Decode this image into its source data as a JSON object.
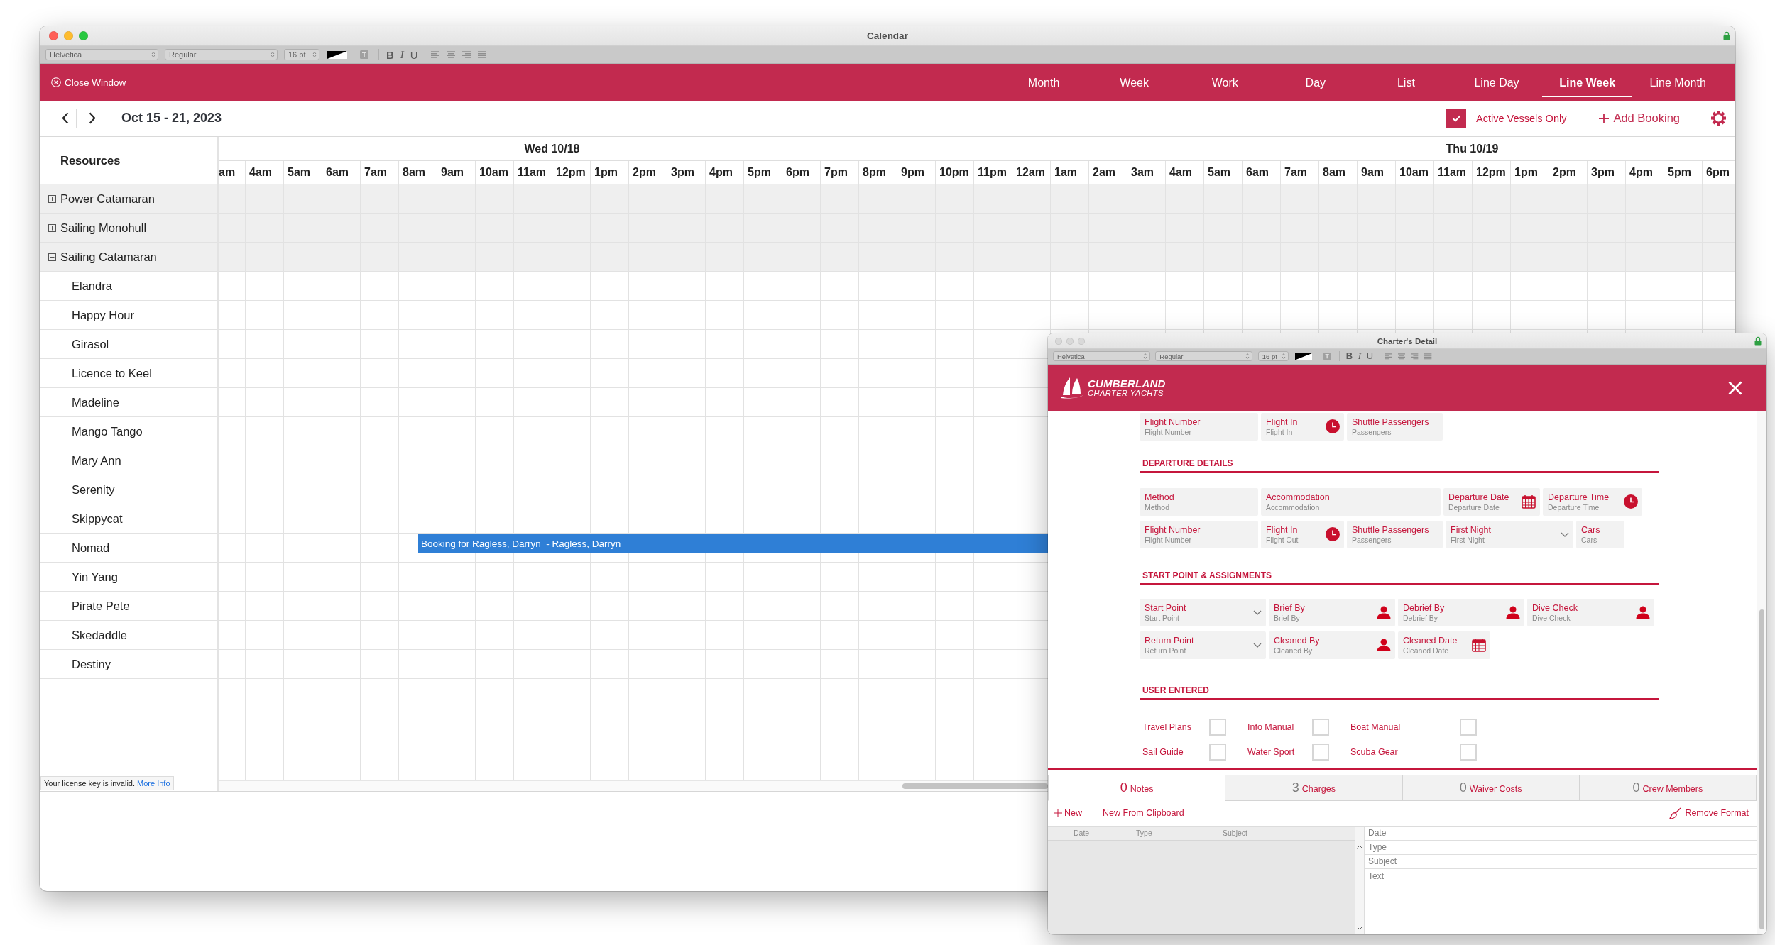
{
  "calendar_window": {
    "title": "Calendar",
    "format_bar": {
      "font": "Helvetica",
      "style": "Regular",
      "size": "16 pt",
      "bold": "B",
      "italic": "I",
      "underline": "U"
    },
    "header": {
      "close_button": "Close Window",
      "views": [
        {
          "label": "Month",
          "selected": false
        },
        {
          "label": "Week",
          "selected": false
        },
        {
          "label": "Work",
          "selected": false
        },
        {
          "label": "Day",
          "selected": false
        },
        {
          "label": "List",
          "selected": false
        },
        {
          "label": "Line Day",
          "selected": false
        },
        {
          "label": "Line Week",
          "selected": true
        },
        {
          "label": "Line Month",
          "selected": false
        }
      ]
    },
    "toolbar": {
      "date_range": "Oct 15 - 21, 2023",
      "active_vessels_only": {
        "label": "Active Vessels Only",
        "checked": true
      },
      "add_booking": "Add Booking"
    },
    "scheduler": {
      "resources_heading": "Resources",
      "days": [
        {
          "label": "Wed 10/18",
          "hours": [
            "am",
            "4am",
            "5am",
            "6am",
            "7am",
            "8am",
            "9am",
            "10am",
            "11am",
            "12pm",
            "1pm",
            "2pm",
            "3pm",
            "4pm",
            "5pm",
            "6pm",
            "7pm",
            "8pm",
            "9pm",
            "10pm",
            "11pm"
          ]
        },
        {
          "label": "Thu 10/19",
          "hours": [
            "12am",
            "1am",
            "2am",
            "3am",
            "4am",
            "5am",
            "6am",
            "7am",
            "8am",
            "9am",
            "10am",
            "11am",
            "12pm",
            "1pm",
            "2pm",
            "3pm",
            "4pm",
            "5pm",
            "6pm"
          ]
        }
      ],
      "resources": [
        {
          "name": "Power Catamaran",
          "expanded": false
        },
        {
          "name": "Sailing Monohull",
          "expanded": false
        },
        {
          "name": "Sailing Catamaran",
          "expanded": true,
          "children": [
            {
              "name": "Elandra"
            },
            {
              "name": "Happy Hour"
            },
            {
              "name": "Girasol"
            },
            {
              "name": "Licence to Keel"
            },
            {
              "name": "Madeline"
            },
            {
              "name": "Mango Tango"
            },
            {
              "name": "Mary Ann"
            },
            {
              "name": "Serenity"
            },
            {
              "name": "Skippycat"
            },
            {
              "name": "Nomad",
              "booking": "Booking for Ragless, Darryn  - Ragless, Darryn"
            },
            {
              "name": "Yin Yang"
            },
            {
              "name": "Pirate Pete"
            },
            {
              "name": "Skedaddle"
            },
            {
              "name": "Destiny"
            }
          ]
        }
      ]
    },
    "license_notice": {
      "text": "Your license key is invalid.",
      "link": "More Info"
    }
  },
  "detail_window": {
    "title": "Charter's Detail",
    "format_bar": {
      "font": "Helvetica",
      "style": "Regular",
      "size": "16 pt",
      "bold": "B",
      "italic": "I",
      "underline": "U"
    },
    "logo": {
      "name": "CUMBERLAND",
      "tagline": "CHARTER YACHTS"
    },
    "sections": [
      {
        "field_groups": [
          {
            "fields": [
              {
                "kind": "text",
                "label": "Flight Number",
                "placeholder": "Flight Number"
              },
              {
                "kind": "time",
                "label": "Flight In",
                "placeholder": "Flight In"
              },
              {
                "kind": "text",
                "label": "Shuttle Passengers",
                "placeholder": "Passengers"
              }
            ]
          }
        ]
      },
      {
        "title": "DEPARTURE DETAILS",
        "field_groups": [
          {
            "fields": [
              {
                "kind": "text",
                "label": "Method",
                "placeholder": "Method"
              },
              {
                "kind": "text",
                "label": "Accommodation",
                "placeholder": "Accommodation"
              },
              {
                "kind": "date",
                "label": "Departure Date",
                "placeholder": "Departure Date"
              },
              {
                "kind": "time",
                "label": "Departure Time",
                "placeholder": "Departure Time"
              }
            ]
          },
          {
            "fields": [
              {
                "kind": "text",
                "label": "Flight Number",
                "placeholder": "Flight Number"
              },
              {
                "kind": "time",
                "label": "Flight In",
                "placeholder": "Flight Out"
              },
              {
                "kind": "text",
                "label": "Shuttle Passengers",
                "placeholder": "Passengers"
              },
              {
                "kind": "select",
                "label": "First Night",
                "placeholder": "First Night"
              },
              {
                "kind": "text",
                "label": "Cars",
                "placeholder": "Cars"
              }
            ]
          }
        ]
      },
      {
        "title": "START POINT & ASSIGNMENTS",
        "field_groups": [
          {
            "fields": [
              {
                "kind": "select",
                "label": "Start Point",
                "placeholder": "Start Point"
              },
              {
                "kind": "person",
                "label": "Brief By",
                "placeholder": "Brief By"
              },
              {
                "kind": "person",
                "label": "Debrief By",
                "placeholder": "Debrief By"
              },
              {
                "kind": "person",
                "label": "Dive Check",
                "placeholder": "Dive Check"
              }
            ]
          },
          {
            "fields": [
              {
                "kind": "select",
                "label": "Return Point",
                "placeholder": "Return Point"
              },
              {
                "kind": "person",
                "label": "Cleaned By",
                "placeholder": "Cleaned By"
              },
              {
                "kind": "date",
                "label": "Cleaned Date",
                "placeholder": "Cleaned Date"
              }
            ]
          }
        ]
      },
      {
        "title": "USER ENTERED",
        "checkboxes": [
          {
            "label": "Travel Plans",
            "checked": false
          },
          {
            "label": "Info Manual",
            "checked": false
          },
          {
            "label": "Boat Manual",
            "checked": false
          },
          {
            "label": "Sail Guide",
            "checked": false
          },
          {
            "label": "Water Sport",
            "checked": false
          },
          {
            "label": "Scuba Gear",
            "checked": false
          }
        ]
      }
    ],
    "tabs": [
      {
        "count": "0",
        "label": "Notes",
        "selected": true
      },
      {
        "count": "3",
        "label": "Charges",
        "selected": false
      },
      {
        "count": "0",
        "label": "Waiver Costs",
        "selected": false
      },
      {
        "count": "0",
        "label": "Crew Members",
        "selected": false
      }
    ],
    "notes_toolbar": {
      "new_button": "New",
      "clipboard_button": "New From Clipboard",
      "remove_format_button": "Remove Format"
    },
    "notes_list": {
      "columns": [
        "Date",
        "Type",
        "Subject"
      ]
    },
    "note_editor": [
      {
        "kind": "line",
        "placeholder": "Date"
      },
      {
        "kind": "line",
        "placeholder": "Type"
      },
      {
        "kind": "line",
        "placeholder": "Subject"
      },
      {
        "kind": "area",
        "placeholder": "Text"
      }
    ]
  }
}
